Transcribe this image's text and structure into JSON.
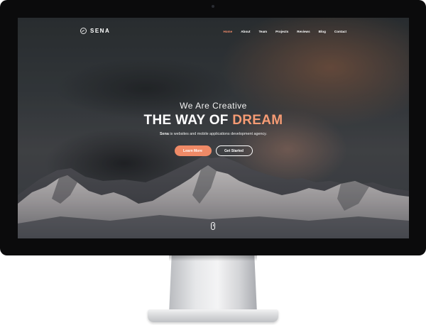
{
  "brand": {
    "name": "SENA",
    "logo_icon": "circle-logo-icon"
  },
  "nav": {
    "items": [
      {
        "label": "Home",
        "active": true
      },
      {
        "label": "About",
        "active": false
      },
      {
        "label": "Team",
        "active": false
      },
      {
        "label": "Projects",
        "active": false
      },
      {
        "label": "Reviews",
        "active": false
      },
      {
        "label": "Blog",
        "active": false
      },
      {
        "label": "Contact",
        "active": false
      }
    ]
  },
  "hero": {
    "kicker": "We Are Creative",
    "title_main": "THE WAY OF ",
    "title_accent": "DREAM",
    "subtitle_brand": "Sena",
    "subtitle_rest": " is websites and mobile applications development agency."
  },
  "cta": {
    "primary_label": "Learn More",
    "secondary_label": "Get Started"
  },
  "colors": {
    "accent": "#ef8a67",
    "monitor_bezel": "#0b0b0c",
    "text_light": "#ffffff"
  },
  "icons": {
    "scroll": "mouse-scroll-icon",
    "camera": "webcam-icon"
  }
}
